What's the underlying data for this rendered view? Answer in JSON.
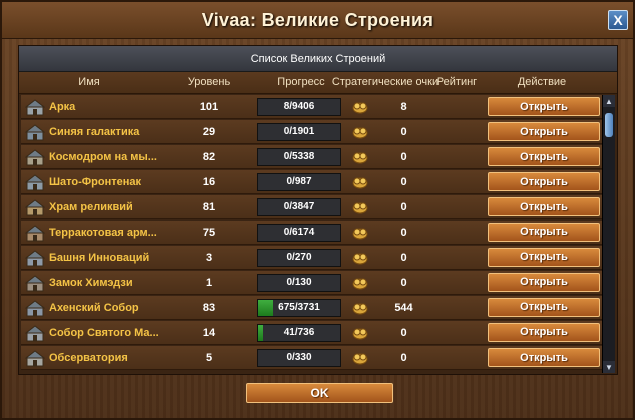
{
  "window": {
    "title": "Vivaa: Великие Строения",
    "close_label": "X"
  },
  "panel": {
    "header": "Список Великих Строений"
  },
  "columns": {
    "name": "Имя",
    "level": "Уровень",
    "progress": "Прогресс",
    "points": "Стратегические очки",
    "rating": "Рейтинг",
    "action": "Действие"
  },
  "rows": [
    {
      "name": "Арка",
      "level": "101",
      "progress": "8/9406",
      "progress_fraction": 0.001,
      "points": "8",
      "action": "Открыть",
      "icon": "arch-icon"
    },
    {
      "name": "Синяя галактика",
      "level": "29",
      "progress": "0/1901",
      "progress_fraction": 0,
      "points": "0",
      "action": "Открыть",
      "icon": "blue-galaxy-icon"
    },
    {
      "name": "Космодром на мы...",
      "level": "82",
      "progress": "0/5338",
      "progress_fraction": 0,
      "points": "0",
      "action": "Открыть",
      "icon": "spaceport-icon"
    },
    {
      "name": "Шато-Фронтенак",
      "level": "16",
      "progress": "0/987",
      "progress_fraction": 0,
      "points": "0",
      "action": "Открыть",
      "icon": "chateau-icon"
    },
    {
      "name": "Храм реликвий",
      "level": "81",
      "progress": "0/3847",
      "progress_fraction": 0,
      "points": "0",
      "action": "Открыть",
      "icon": "temple-icon"
    },
    {
      "name": "Терракотовая арм...",
      "level": "75",
      "progress": "0/6174",
      "progress_fraction": 0,
      "points": "0",
      "action": "Открыть",
      "icon": "terracotta-icon"
    },
    {
      "name": "Башня Инноваций",
      "level": "3",
      "progress": "0/270",
      "progress_fraction": 0,
      "points": "0",
      "action": "Открыть",
      "icon": "innovation-tower-icon"
    },
    {
      "name": "Замок Химэдзи",
      "level": "1",
      "progress": "0/130",
      "progress_fraction": 0,
      "points": "0",
      "action": "Открыть",
      "icon": "himeji-castle-icon"
    },
    {
      "name": "Ахенский Собор",
      "level": "83",
      "progress": "675/3731",
      "progress_fraction": 0.181,
      "points": "544",
      "action": "Открыть",
      "icon": "aachen-cathedral-icon"
    },
    {
      "name": "Собор Святого Ма...",
      "level": "14",
      "progress": "41/736",
      "progress_fraction": 0.056,
      "points": "0",
      "action": "Открыть",
      "icon": "st-mark-cathedral-icon"
    },
    {
      "name": "Обсерватория",
      "level": "5",
      "progress": "0/330",
      "progress_fraction": 0,
      "points": "0",
      "action": "Открыть",
      "icon": "observatory-icon"
    }
  ],
  "footer": {
    "ok_label": "OK"
  },
  "colors": {
    "accent_gold": "#f4c346",
    "button_orange": "#c0702c",
    "progress_green": "#2f9a2f"
  }
}
